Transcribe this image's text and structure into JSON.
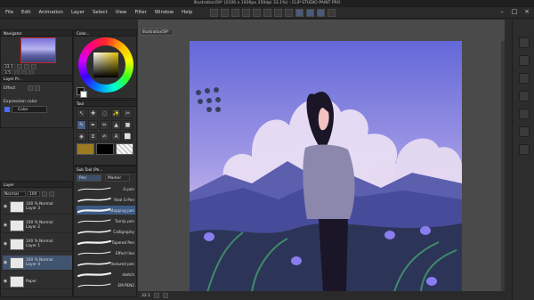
{
  "window": {
    "title": "Illustration59* (2106 x 1926px 350dpi 33.1%)  - CLIP STUDIO PAINT PRO"
  },
  "menu": [
    "File",
    "Edit",
    "Animation",
    "Layer",
    "Select",
    "View",
    "Filter",
    "Window",
    "Help"
  ],
  "navigator": {
    "zoom": "33.1",
    "angle": "3.5"
  },
  "layer_property": {
    "tab": "Layer Pr...",
    "effect_label": "Effect",
    "expression_color_label": "Expression color",
    "expression_color_value": "Color"
  },
  "color_panel": {
    "tab": "Color..."
  },
  "tool_panel": {
    "tab": "Tool",
    "tools": [
      "↖",
      "✚",
      "◌",
      "✨",
      "✂",
      "✎",
      "✒",
      "✏",
      "▲",
      "■",
      "◈",
      "⧖",
      "✍",
      "A",
      "⬜"
    ]
  },
  "subtool_panel": {
    "tab": "Sub Tool (Pe...",
    "tabs": [
      "Pen",
      "Marker"
    ],
    "brushes": [
      {
        "name": "G-pen",
        "selected": false
      },
      {
        "name": "Real G-Pen",
        "selected": false
      },
      {
        "name": "Mapping pen",
        "selected": true
      },
      {
        "name": "Turnip pen",
        "selected": false
      },
      {
        "name": "Calligraphy",
        "selected": false
      },
      {
        "name": "Tapered Pen",
        "selected": false
      },
      {
        "name": "Effect line",
        "selected": false
      },
      {
        "name": "Textured pen",
        "selected": false
      },
      {
        "name": "sketch",
        "selected": false
      },
      {
        "name": "EM PEN2",
        "selected": false
      }
    ]
  },
  "layer_panel": {
    "tab": "Layer",
    "blend": "Normal",
    "opacity": "100",
    "layers": [
      {
        "line1": "100 % Normal",
        "line2": "Layer 3",
        "selected": false
      },
      {
        "line1": "100 % Normal",
        "line2": "Layer 2",
        "selected": false
      },
      {
        "line1": "100 % Normal",
        "line2": "Layer 1",
        "selected": false
      },
      {
        "line1": "100 % Normal",
        "line2": "Layer 4",
        "selected": true
      },
      {
        "line1": "",
        "line2": "Paper",
        "selected": false
      }
    ]
  },
  "canvas": {
    "doc_tab": "Illustration59*",
    "zoom_status": "33.1"
  },
  "colors": {
    "accent": "#4a5e86",
    "sky_top": "#6a6ee0",
    "sky_mid": "#a49ae8",
    "mountain": "#474c9a",
    "grass": "#2c3558"
  }
}
